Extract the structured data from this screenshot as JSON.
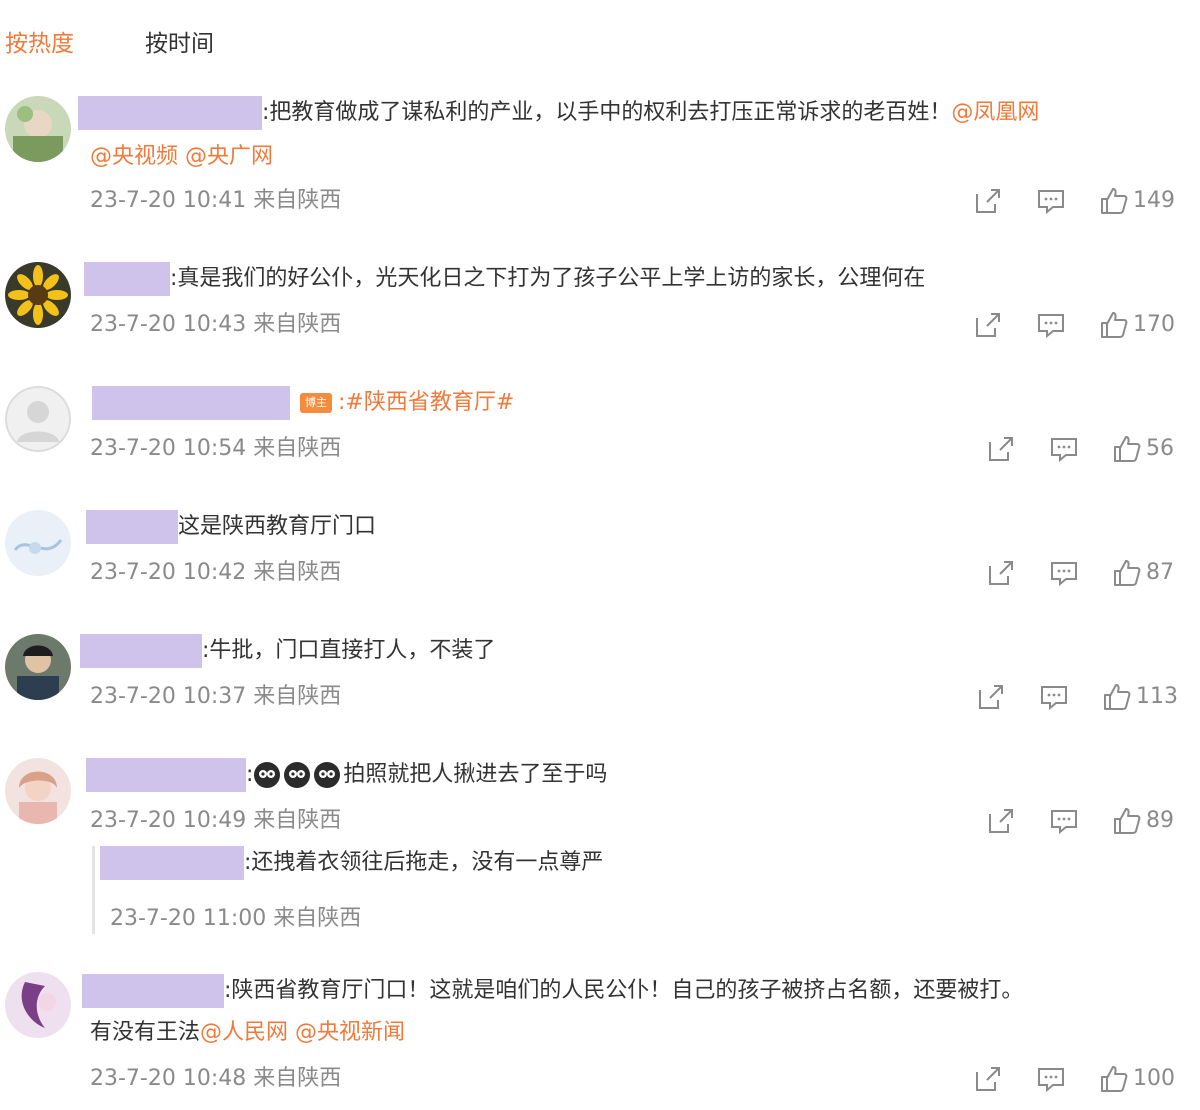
{
  "sort_tabs": {
    "hot": "按热度",
    "time": "按时间"
  },
  "colors": {
    "accent": "#f07a3a",
    "name_redaction": "#cfc3ec",
    "meta": "#8a8a8a",
    "text": "#333333"
  },
  "icons": {
    "share": "share-icon",
    "comment": "comment-icon",
    "like": "thumbs-up-icon"
  },
  "comments": [
    {
      "text": ":把教育做成了谋私利的产业，以手中的权利去打压正常诉求的老百姓！",
      "mentions_inline": "@凤凰网",
      "mentions_line2": "@央视频 @央广网",
      "meta": "23-7-20 10:41 来自陕西",
      "likes": "149"
    },
    {
      "text": ":真是我们的好公仆，光天化日之下打为了孩子公平上学上访的家长，公理何在",
      "meta": "23-7-20 10:43 来自陕西",
      "likes": "170"
    },
    {
      "badge": "博主",
      "mention": ":#陕西省教育厅#",
      "meta": "23-7-20 10:54 来自陕西",
      "likes": "56"
    },
    {
      "text": "这是陕西教育厅门口",
      "meta": "23-7-20 10:42 来自陕西",
      "likes": "87"
    },
    {
      "text": ":牛批，门口直接打人，不装了",
      "meta": "23-7-20 10:37 来自陕西",
      "likes": "113"
    },
    {
      "text": "拍照就把人揪进去了至于吗",
      "meta": "23-7-20 10:49 来自陕西",
      "likes": "89",
      "reply": {
        "text": ":还拽着衣领往后拖走，没有一点尊严",
        "meta": "23-7-20 11:00 来自陕西"
      }
    },
    {
      "text": ":陕西省教育厅门口！这就是咱们的人民公仆！自己的孩子被挤占名额，还要被打。",
      "text_line2": "有没有王法",
      "mentions_line2": "@人民网 @央视新闻",
      "meta": "23-7-20 10:48 来自陕西",
      "likes": "100"
    }
  ]
}
